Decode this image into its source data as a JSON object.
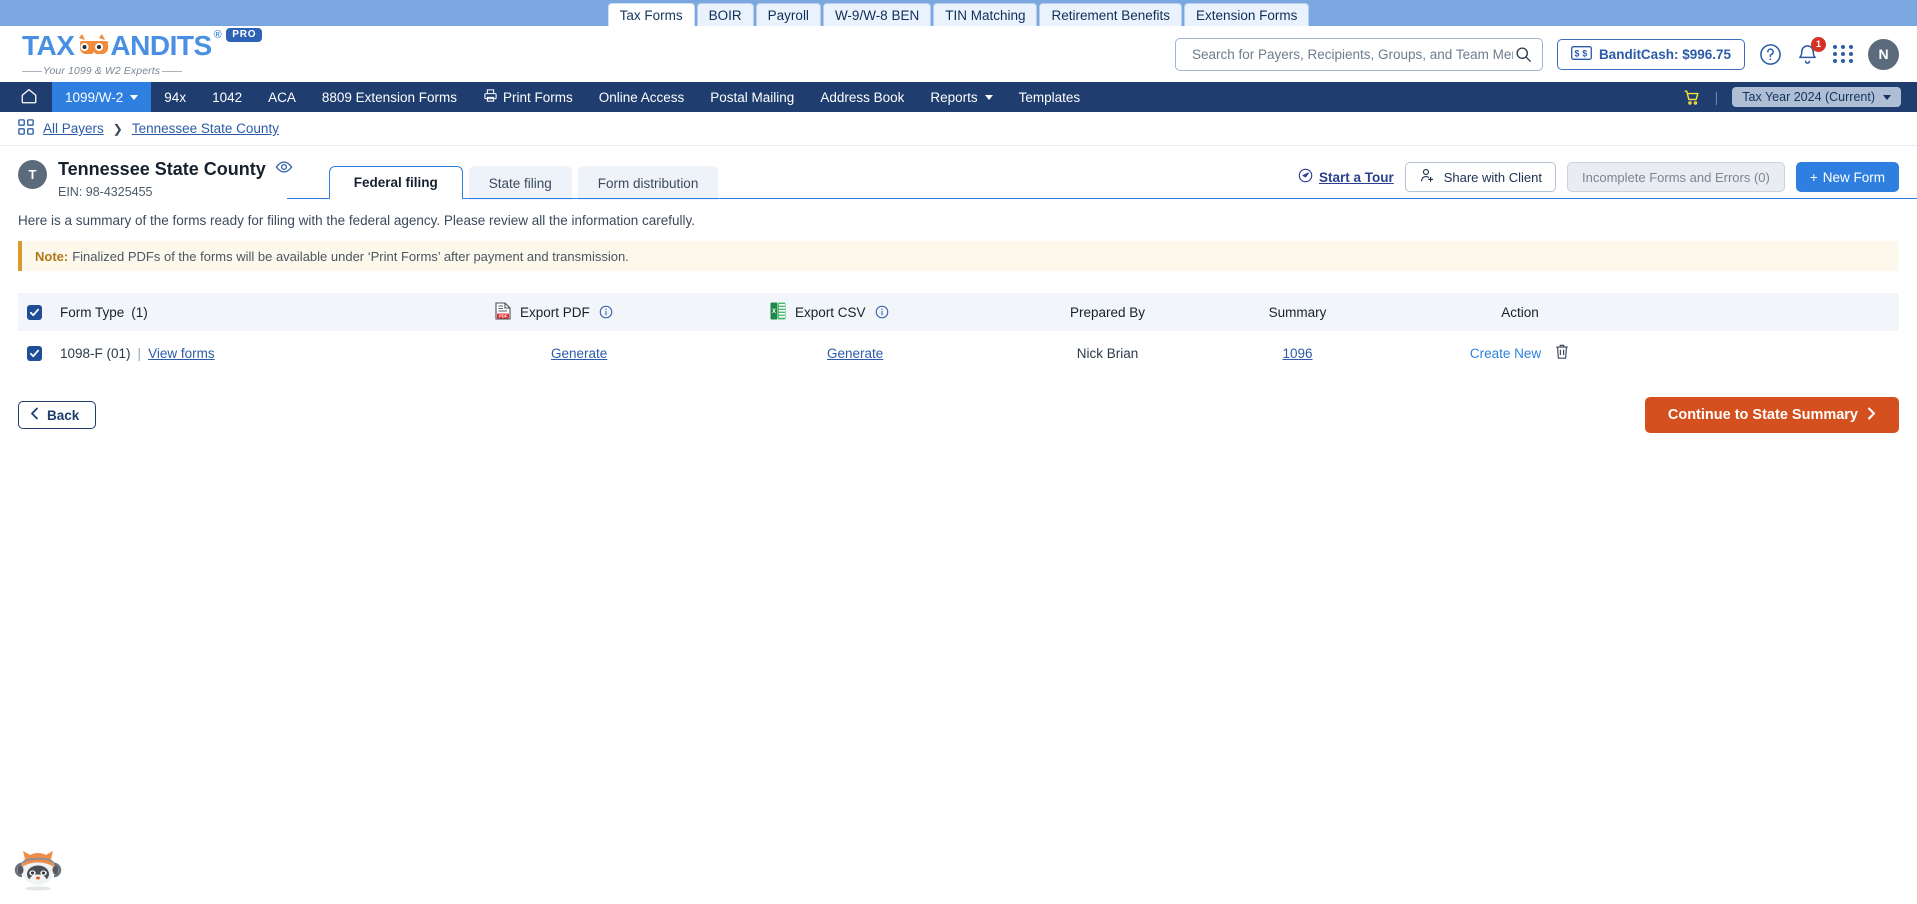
{
  "product_tabs": [
    {
      "label": "Tax Forms",
      "active": true
    },
    {
      "label": "BOIR",
      "active": false
    },
    {
      "label": "Payroll",
      "active": false
    },
    {
      "label": "W-9/W-8 BEN",
      "active": false
    },
    {
      "label": "TIN Matching",
      "active": false
    },
    {
      "label": "Retirement Benefits",
      "active": false
    },
    {
      "label": "Extension Forms",
      "active": false
    }
  ],
  "brand": {
    "name_left": "TAX",
    "name_right": "ANDITS",
    "registered": "®",
    "pro_badge": "PRO",
    "tagline": "Your 1099 & W2 Experts",
    "logo_color": "#4a90e2",
    "pro_bg": "#2d62b5"
  },
  "search": {
    "placeholder": "Search for Payers, Recipients, Groups, and Team Members",
    "value": "",
    "icon": "search-icon"
  },
  "header_right": {
    "bandit_cash_label": "BanditCash: $996.75",
    "bandit_icon": "cash-bill-icon",
    "help_icon": "question-circle-icon",
    "notification_icon": "bell-icon",
    "notification_count": "1",
    "apps_icon": "apps-grid-icon",
    "avatar_initial": "N"
  },
  "main_nav": {
    "home_icon": "home-icon",
    "items": [
      {
        "label": "1099/W-2",
        "active": true,
        "caret": true,
        "icon": null
      },
      {
        "label": "94x",
        "active": false,
        "caret": false,
        "icon": null
      },
      {
        "label": "1042",
        "active": false,
        "caret": false,
        "icon": null
      },
      {
        "label": "ACA",
        "active": false,
        "caret": false,
        "icon": null
      },
      {
        "label": "8809 Extension Forms",
        "active": false,
        "caret": false,
        "icon": null
      },
      {
        "label": "Print Forms",
        "active": false,
        "caret": false,
        "icon": "printer-icon"
      },
      {
        "label": "Online Access",
        "active": false,
        "caret": false,
        "icon": null
      },
      {
        "label": "Postal Mailing",
        "active": false,
        "caret": false,
        "icon": null
      },
      {
        "label": "Address Book",
        "active": false,
        "caret": false,
        "icon": null
      },
      {
        "label": "Reports",
        "active": false,
        "caret": true,
        "icon": null
      },
      {
        "label": "Templates",
        "active": false,
        "caret": false,
        "icon": null
      }
    ],
    "cart_icon": "shopping-cart-icon",
    "separator": "|",
    "tax_year": "Tax Year 2024 (Current)"
  },
  "breadcrumb": {
    "grid_icon": "grid-apps-icon",
    "items": [
      "All Payers",
      "Tennessee State County"
    ],
    "separator": "❯"
  },
  "payer": {
    "avatar_initial": "T",
    "name": "Tennessee State County",
    "eye_icon": "eye-icon",
    "ein": "EIN: 98-4325455"
  },
  "filing_tabs": [
    {
      "label": "Federal filing",
      "active": true
    },
    {
      "label": "State filing",
      "active": false
    },
    {
      "label": "Form distribution",
      "active": false
    }
  ],
  "header_actions": {
    "start_tour": "Start a Tour",
    "start_tour_icon": "compass-icon",
    "share_with_client": "Share with Client",
    "share_icon": "user-add-icon",
    "incomplete_forms": "Incomplete Forms and Errors (0)",
    "new_form": "New  Form",
    "new_form_plus": "+"
  },
  "content": {
    "summary_text": "Here is a summary of the forms ready for filing with the federal agency. Please review all the information carefully.",
    "note_label": "Note:",
    "note_text": "Finalized PDFs of the forms will be available under ‘Print Forms’ after payment and transmission.",
    "note_accent": "#d89b2c"
  },
  "table": {
    "columns": [
      {
        "label": "Form Type",
        "count": "(1)",
        "icon": null
      },
      {
        "label": "Export PDF",
        "icon": "pdf-file-icon",
        "info": "info-icon"
      },
      {
        "label": "Export CSV",
        "icon": "excel-file-icon",
        "info": "info-icon"
      },
      {
        "label": "Prepared By",
        "icon": null
      },
      {
        "label": "Summary",
        "icon": null
      },
      {
        "label": "Action",
        "icon": null
      }
    ],
    "rows": [
      {
        "checked": true,
        "form_type": "1098-F (01)",
        "separator": "|",
        "view_forms": "View forms",
        "export_pdf": "Generate",
        "export_csv": "Generate",
        "prepared_by": "Nick Brian",
        "summary": "1096",
        "action": "Create New",
        "delete_icon": "trash-icon"
      }
    ],
    "header_checked": true
  },
  "footer": {
    "back_label": "Back",
    "back_icon": "chevron-left-icon",
    "continue_label": "Continue to State Summary",
    "continue_icon": "chevron-right-icon",
    "continue_color": "#d4501e"
  },
  "chat_widget": {
    "icon": "raccoon-mascot-icon"
  }
}
